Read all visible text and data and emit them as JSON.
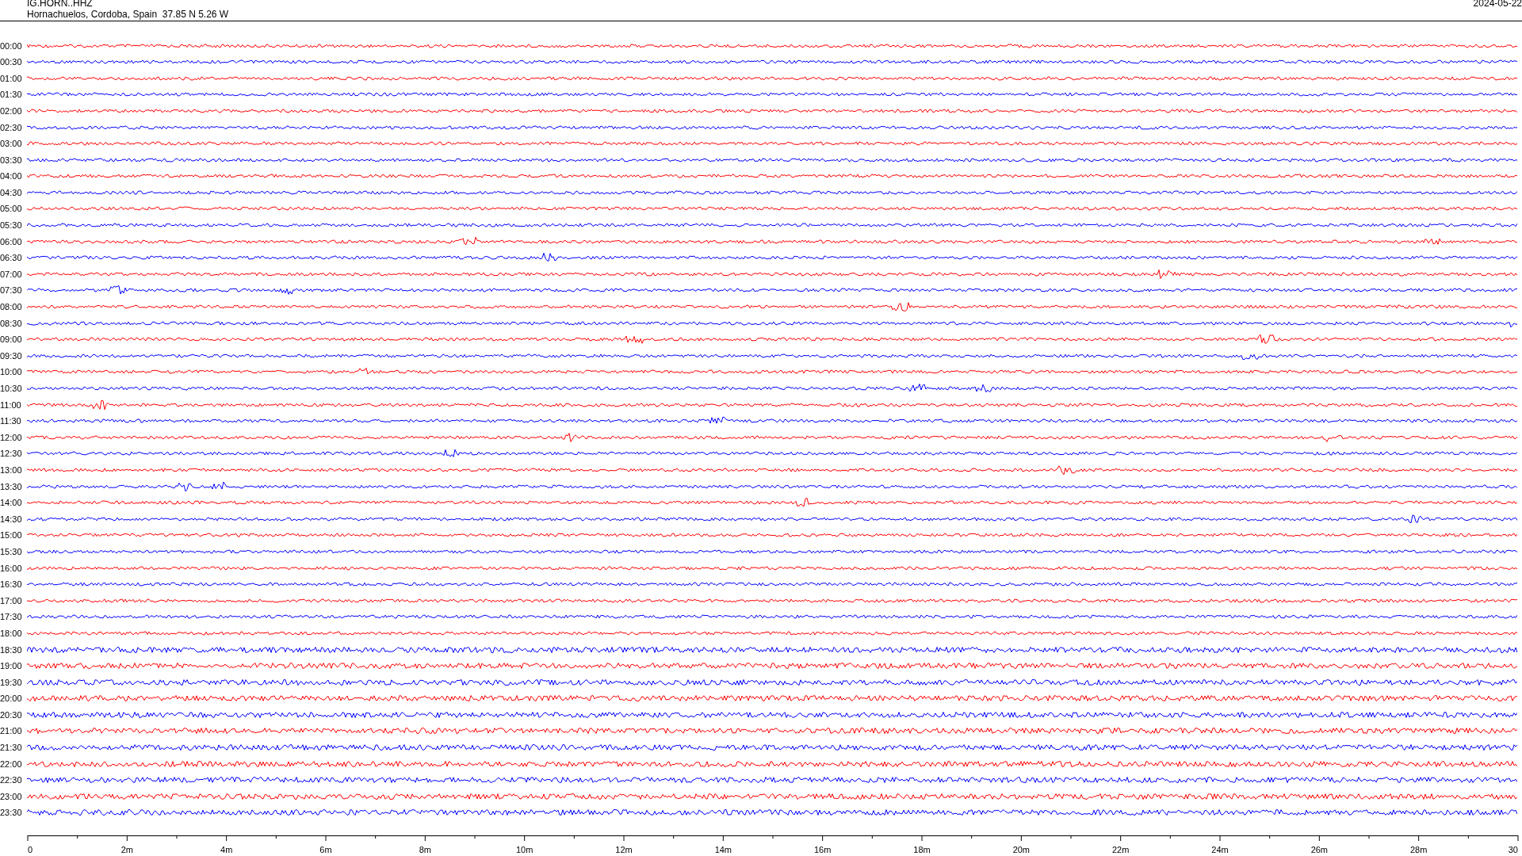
{
  "header": {
    "station": "IG.HORN..HHZ",
    "location": "Hornachuelos, Cordoba, Spain  37.85 N 5.26 W",
    "date": "2024-05-22"
  },
  "rows": [
    {
      "time": "00:00",
      "color": "#ff0000"
    },
    {
      "time": "00:30",
      "color": "#0000ff"
    },
    {
      "time": "01:00",
      "color": "#ff0000"
    },
    {
      "time": "01:30",
      "color": "#0000ff"
    },
    {
      "time": "02:00",
      "color": "#ff0000"
    },
    {
      "time": "02:30",
      "color": "#0000ff"
    },
    {
      "time": "03:00",
      "color": "#ff0000"
    },
    {
      "time": "03:30",
      "color": "#0000ff"
    },
    {
      "time": "04:00",
      "color": "#ff0000"
    },
    {
      "time": "04:30",
      "color": "#0000ff"
    },
    {
      "time": "05:00",
      "color": "#ff0000"
    },
    {
      "time": "05:30",
      "color": "#0000ff"
    },
    {
      "time": "06:00",
      "color": "#ff0000"
    },
    {
      "time": "06:30",
      "color": "#0000ff"
    },
    {
      "time": "07:00",
      "color": "#ff0000"
    },
    {
      "time": "07:30",
      "color": "#0000ff"
    },
    {
      "time": "08:00",
      "color": "#ff0000"
    },
    {
      "time": "08:30",
      "color": "#0000ff"
    },
    {
      "time": "09:00",
      "color": "#ff0000"
    },
    {
      "time": "09:30",
      "color": "#0000ff"
    },
    {
      "time": "10:00",
      "color": "#ff0000"
    },
    {
      "time": "10:30",
      "color": "#0000ff"
    },
    {
      "time": "11:00",
      "color": "#ff0000"
    },
    {
      "time": "11:30",
      "color": "#0000ff"
    },
    {
      "time": "12:00",
      "color": "#ff0000"
    },
    {
      "time": "12:30",
      "color": "#0000ff"
    },
    {
      "time": "13:00",
      "color": "#ff0000"
    },
    {
      "time": "13:30",
      "color": "#0000ff"
    },
    {
      "time": "14:00",
      "color": "#ff0000"
    },
    {
      "time": "14:30",
      "color": "#0000ff"
    },
    {
      "time": "15:00",
      "color": "#ff0000"
    },
    {
      "time": "15:30",
      "color": "#0000ff"
    },
    {
      "time": "16:00",
      "color": "#ff0000"
    },
    {
      "time": "16:30",
      "color": "#0000ff"
    },
    {
      "time": "17:00",
      "color": "#ff0000"
    },
    {
      "time": "17:30",
      "color": "#0000ff"
    },
    {
      "time": "18:00",
      "color": "#ff0000"
    },
    {
      "time": "18:30",
      "color": "#0000ff"
    },
    {
      "time": "19:00",
      "color": "#ff0000"
    },
    {
      "time": "19:30",
      "color": "#0000ff"
    },
    {
      "time": "20:00",
      "color": "#ff0000"
    },
    {
      "time": "20:30",
      "color": "#0000ff"
    },
    {
      "time": "21:00",
      "color": "#ff0000"
    },
    {
      "time": "21:30",
      "color": "#0000ff"
    },
    {
      "time": "22:00",
      "color": "#ff0000"
    },
    {
      "time": "22:30",
      "color": "#0000ff"
    },
    {
      "time": "23:00",
      "color": "#ff0000"
    },
    {
      "time": "23:30",
      "color": "#0000ff"
    }
  ],
  "x_axis": {
    "labels": [
      "0",
      "2m",
      "4m",
      "6m",
      "8m",
      "10m",
      "12m",
      "14m",
      "16m",
      "18m",
      "20m",
      "22m",
      "24m",
      "26m",
      "28m",
      "30"
    ]
  }
}
